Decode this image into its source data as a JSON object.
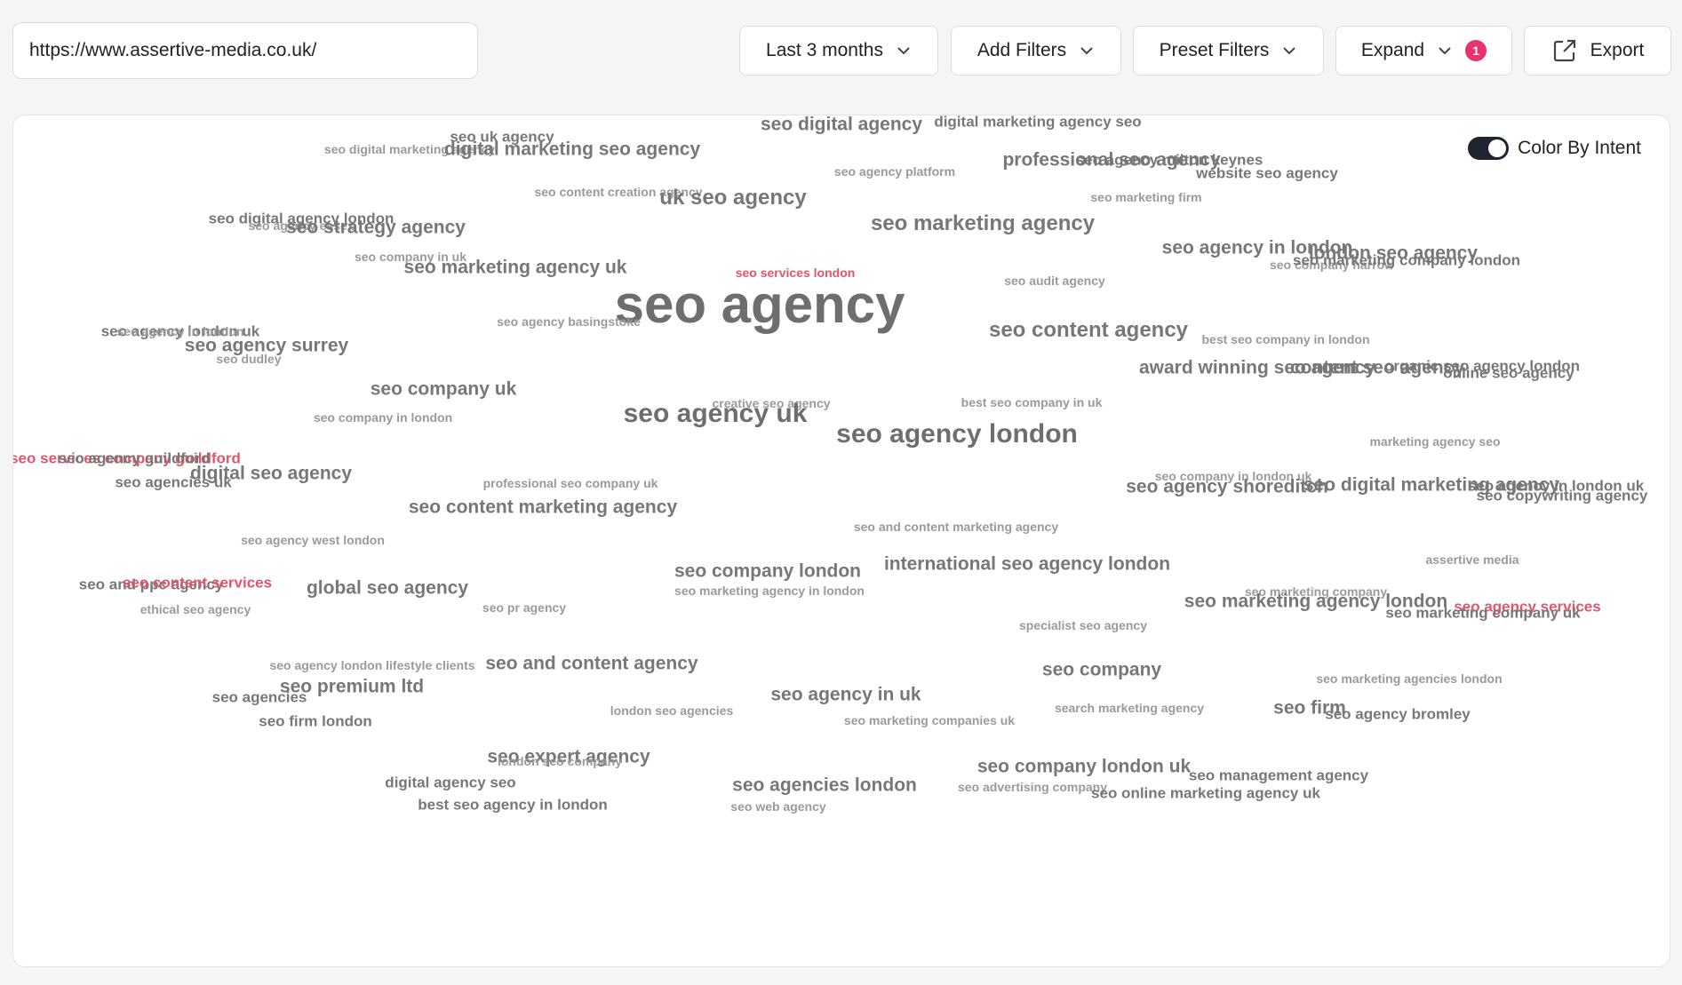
{
  "url_input": {
    "value": "https://www.assertive-media.co.uk/"
  },
  "toolbar": {
    "date_range_label": "Last 3 months",
    "add_filters_label": "Add Filters",
    "preset_filters_label": "Preset Filters",
    "expand_label": "Expand",
    "expand_badge": "1",
    "export_label": "Export"
  },
  "cloud": {
    "color_by_intent_label": "Color By Intent",
    "color_by_intent_on": true,
    "colors": {
      "default": "#777777",
      "commercial": "#e0566d"
    },
    "words": [
      {
        "text": "seo digital agency",
        "tier": 3,
        "intent": "default"
      },
      {
        "text": "digital marketing agency seo",
        "tier": 2,
        "intent": "default"
      },
      {
        "text": "seo uk agency",
        "tier": 2,
        "intent": "default"
      },
      {
        "text": "seo digital marketing agency",
        "tier": 1,
        "intent": "default"
      },
      {
        "text": "digital marketing seo agency",
        "tier": 3,
        "intent": "default"
      },
      {
        "text": "professional seo agency",
        "tier": 3,
        "intent": "default"
      },
      {
        "text": "seo agency milton keynes",
        "tier": 2,
        "intent": "default"
      },
      {
        "text": "seo agency platform",
        "tier": 1,
        "intent": "default"
      },
      {
        "text": "website seo agency",
        "tier": 2,
        "intent": "default"
      },
      {
        "text": "seo content creation agency",
        "tier": 1,
        "intent": "default"
      },
      {
        "text": "uk seo agency",
        "tier": 4,
        "intent": "default"
      },
      {
        "text": "seo marketing firm",
        "tier": 1,
        "intent": "default"
      },
      {
        "text": "seo digital agency london",
        "tier": 2,
        "intent": "default"
      },
      {
        "text": "seo agency essex",
        "tier": 1,
        "intent": "default"
      },
      {
        "text": "seo strategy agency",
        "tier": 3,
        "intent": "default"
      },
      {
        "text": "seo marketing agency",
        "tier": 4,
        "intent": "default"
      },
      {
        "text": "seo agency in london",
        "tier": 3,
        "intent": "default"
      },
      {
        "text": "london seo agency",
        "tier": 3,
        "intent": "default"
      },
      {
        "text": "seo company in uk",
        "tier": 1,
        "intent": "default"
      },
      {
        "text": "seo marketing agency uk",
        "tier": 3,
        "intent": "default"
      },
      {
        "text": "seo services london",
        "tier": 1,
        "intent": "commercial"
      },
      {
        "text": "seo company harrow",
        "tier": 1,
        "intent": "default"
      },
      {
        "text": "seo marketing company london",
        "tier": 2,
        "intent": "default"
      },
      {
        "text": "seo audit agency",
        "tier": 1,
        "intent": "default"
      },
      {
        "text": "seo agency",
        "tier": 7,
        "intent": "default"
      },
      {
        "text": "seo agency basingstoke",
        "tier": 1,
        "intent": "default"
      },
      {
        "text": "seo agency london uk",
        "tier": 2,
        "intent": "default"
      },
      {
        "text": "seo agency in london",
        "tier": 1,
        "intent": "default"
      },
      {
        "text": "seo agency surrey",
        "tier": 3,
        "intent": "default"
      },
      {
        "text": "seo content agency",
        "tier": 4,
        "intent": "default"
      },
      {
        "text": "seo dudley",
        "tier": 1,
        "intent": "default"
      },
      {
        "text": "best seo company in london",
        "tier": 1,
        "intent": "default"
      },
      {
        "text": "award winning seo agency",
        "tier": 3,
        "intent": "default"
      },
      {
        "text": "content seo agency",
        "tier": 3,
        "intent": "default"
      },
      {
        "text": "organic seo agency london",
        "tier": 2,
        "intent": "default"
      },
      {
        "text": "online seo agency",
        "tier": 2,
        "intent": "default"
      },
      {
        "text": "seo company uk",
        "tier": 3,
        "intent": "default"
      },
      {
        "text": "creative seo agency",
        "tier": 1,
        "intent": "default"
      },
      {
        "text": "best seo company in uk",
        "tier": 1,
        "intent": "default"
      },
      {
        "text": "seo agency uk",
        "tier": 5,
        "intent": "default"
      },
      {
        "text": "seo company in london",
        "tier": 1,
        "intent": "default"
      },
      {
        "text": "seo agency london",
        "tier": 5,
        "intent": "default"
      },
      {
        "text": "marketing agency seo",
        "tier": 1,
        "intent": "default"
      },
      {
        "text": "seo services company guildford",
        "tier": 2,
        "intent": "commercial"
      },
      {
        "text": "seo agency guildford",
        "tier": 2,
        "intent": "default"
      },
      {
        "text": "digital seo agency",
        "tier": 3,
        "intent": "default"
      },
      {
        "text": "seo agencies uk",
        "tier": 2,
        "intent": "default"
      },
      {
        "text": "professional seo company uk",
        "tier": 1,
        "intent": "default"
      },
      {
        "text": "seo company in london uk",
        "tier": 1,
        "intent": "default"
      },
      {
        "text": "seo agency shoreditch",
        "tier": 3,
        "intent": "default"
      },
      {
        "text": "seo digital marketing agency",
        "tier": 3,
        "intent": "default"
      },
      {
        "text": "seo agency in london uk",
        "tier": 2,
        "intent": "default"
      },
      {
        "text": "seo copywriting agency",
        "tier": 2,
        "intent": "default"
      },
      {
        "text": "seo content marketing agency",
        "tier": 3,
        "intent": "default"
      },
      {
        "text": "seo agency west london",
        "tier": 1,
        "intent": "default"
      },
      {
        "text": "seo and content marketing agency",
        "tier": 1,
        "intent": "default"
      },
      {
        "text": "seo company london",
        "tier": 3,
        "intent": "default"
      },
      {
        "text": "international seo agency london",
        "tier": 3,
        "intent": "default"
      },
      {
        "text": "assertive media",
        "tier": 1,
        "intent": "default"
      },
      {
        "text": "seo and ppc agency",
        "tier": 2,
        "intent": "default"
      },
      {
        "text": "seo content services",
        "tier": 2,
        "intent": "commercial"
      },
      {
        "text": "global seo agency",
        "tier": 3,
        "intent": "default"
      },
      {
        "text": "seo marketing agency in london",
        "tier": 1,
        "intent": "default"
      },
      {
        "text": "seo marketing company",
        "tier": 1,
        "intent": "default"
      },
      {
        "text": "seo marketing agency london",
        "tier": 3,
        "intent": "default"
      },
      {
        "text": "seo agency services",
        "tier": 2,
        "intent": "commercial"
      },
      {
        "text": "seo marketing company uk",
        "tier": 2,
        "intent": "default"
      },
      {
        "text": "ethical seo agency",
        "tier": 1,
        "intent": "default"
      },
      {
        "text": "seo pr agency",
        "tier": 1,
        "intent": "default"
      },
      {
        "text": "specialist seo agency",
        "tier": 1,
        "intent": "default"
      },
      {
        "text": "seo agency london lifestyle clients",
        "tier": 1,
        "intent": "default"
      },
      {
        "text": "seo and content agency",
        "tier": 3,
        "intent": "default"
      },
      {
        "text": "seo company",
        "tier": 3,
        "intent": "default"
      },
      {
        "text": "seo premium ltd",
        "tier": 3,
        "intent": "default"
      },
      {
        "text": "seo agencies",
        "tier": 2,
        "intent": "default"
      },
      {
        "text": "seo agency in uk",
        "tier": 3,
        "intent": "default"
      },
      {
        "text": "seo marketing agencies london",
        "tier": 1,
        "intent": "default"
      },
      {
        "text": "london seo agencies",
        "tier": 1,
        "intent": "default"
      },
      {
        "text": "search marketing agency",
        "tier": 1,
        "intent": "default"
      },
      {
        "text": "seo firm",
        "tier": 3,
        "intent": "default"
      },
      {
        "text": "seo agency bromley",
        "tier": 2,
        "intent": "default"
      },
      {
        "text": "seo firm london",
        "tier": 2,
        "intent": "default"
      },
      {
        "text": "seo marketing companies uk",
        "tier": 1,
        "intent": "default"
      },
      {
        "text": "seo expert agency",
        "tier": 3,
        "intent": "default"
      },
      {
        "text": "london seo company",
        "tier": 1,
        "intent": "default"
      },
      {
        "text": "seo company london uk",
        "tier": 3,
        "intent": "default"
      },
      {
        "text": "seo management agency",
        "tier": 2,
        "intent": "default"
      },
      {
        "text": "digital agency seo",
        "tier": 2,
        "intent": "default"
      },
      {
        "text": "seo agencies london",
        "tier": 3,
        "intent": "default"
      },
      {
        "text": "seo advertising company",
        "tier": 1,
        "intent": "default"
      },
      {
        "text": "seo online marketing agency uk",
        "tier": 2,
        "intent": "default"
      },
      {
        "text": "best seo agency in london",
        "tier": 2,
        "intent": "default"
      },
      {
        "text": "seo web agency",
        "tier": 1,
        "intent": "default"
      }
    ]
  }
}
